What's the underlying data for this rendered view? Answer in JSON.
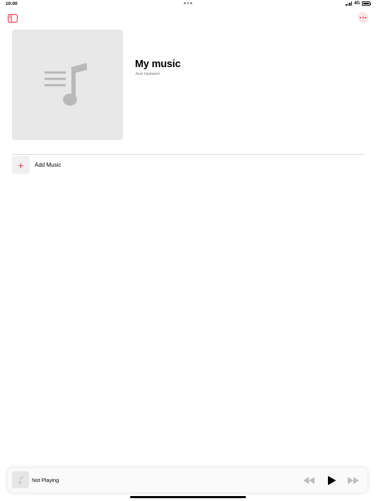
{
  "status_bar": {
    "time": "10:00",
    "network": "4G"
  },
  "toolbar": {
    "sidebar_icon": "sidebar-toggle-icon",
    "more_icon": "ellipsis-icon"
  },
  "playlist": {
    "title": "My music",
    "subtitle": "Just Updated",
    "artwork_icon": "music-note-icon"
  },
  "actions": {
    "add_music_label": "Add Music",
    "add_music_icon": "plus-icon"
  },
  "player": {
    "status": "Not Playing",
    "controls": [
      "rewind-icon",
      "play-icon",
      "forward-icon"
    ]
  },
  "colors": {
    "accent": "#e8344b",
    "artwork_bg": "#e8e8e8",
    "subtitle": "#9a9a9a"
  }
}
